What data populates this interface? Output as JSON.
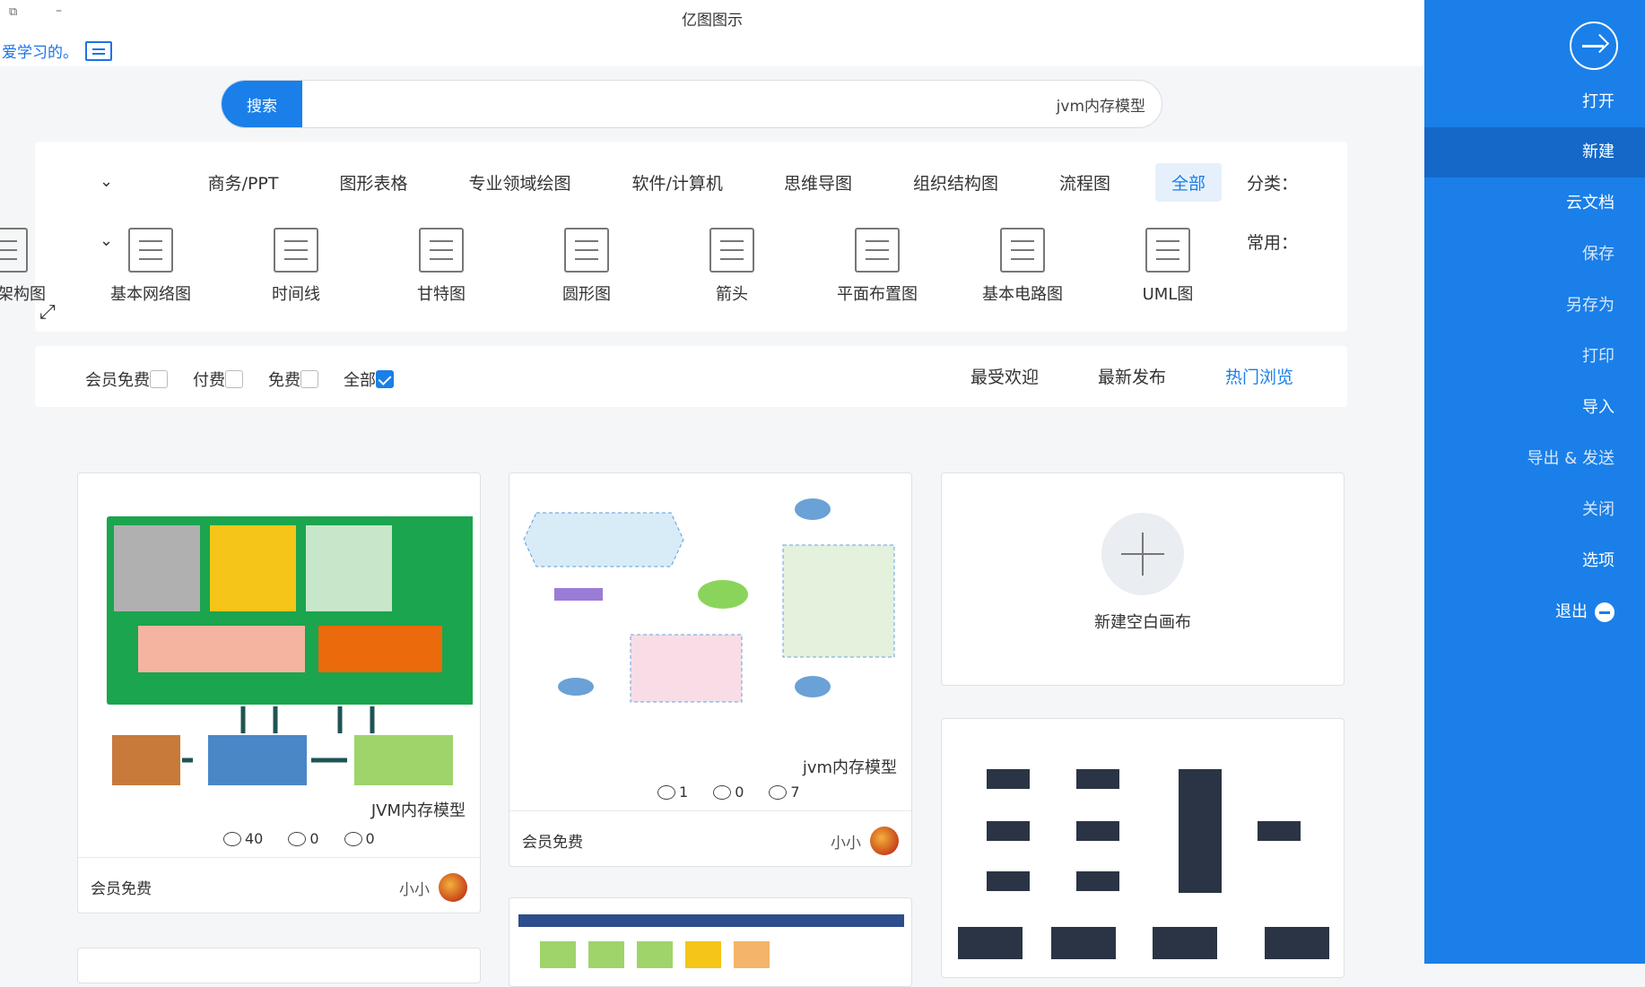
{
  "window": {
    "title": "亿图图示",
    "ctrl_restore": "⧉",
    "ctrl_min": "–"
  },
  "user": {
    "name": "爱学习的。"
  },
  "search": {
    "button_label": "搜索",
    "value": "jvm内存模型"
  },
  "categories": {
    "label": "分类：",
    "items": [
      "全部",
      "流程图",
      "组织结构图",
      "思维导图",
      "软件/计算机",
      "专业领域绘图",
      "图形表格",
      "商务/PPT"
    ],
    "active": "全部"
  },
  "common": {
    "label": "常用：",
    "items": [
      "UML图",
      "基本电路图",
      "平面布置图",
      "箭头",
      "圆形图",
      "甘特图",
      "时间线",
      "基本网络图",
      "程序架构图"
    ]
  },
  "sort_tabs": {
    "items": [
      "热门浏览",
      "最新发布",
      "最受欢迎"
    ],
    "active": "热门浏览"
  },
  "price_filters": {
    "items": [
      "全部",
      "免费",
      "付费",
      "会员免费"
    ],
    "checked": "全部"
  },
  "new_blank": {
    "label": "新建空白画布"
  },
  "cards": [
    {
      "title": "JVM内存模型",
      "views": "40",
      "likes": "0",
      "favs": "0",
      "price": "会员免费",
      "author": "小小"
    },
    {
      "title": "jvm内存模型",
      "views": "7",
      "likes": "0",
      "favs": "1",
      "price": "会员免费",
      "author": "小小"
    }
  ],
  "sidebar": {
    "items": [
      "打开",
      "新建",
      "云文档",
      "保存",
      "另存为",
      "打印",
      "导入",
      "导出 & 发送",
      "关闭",
      "选项",
      "退出"
    ],
    "active": "新建"
  },
  "colors": {
    "accent": "#1a7fe8",
    "sidebar": "#1a7fe8",
    "sidebar_active": "#1468c7"
  }
}
